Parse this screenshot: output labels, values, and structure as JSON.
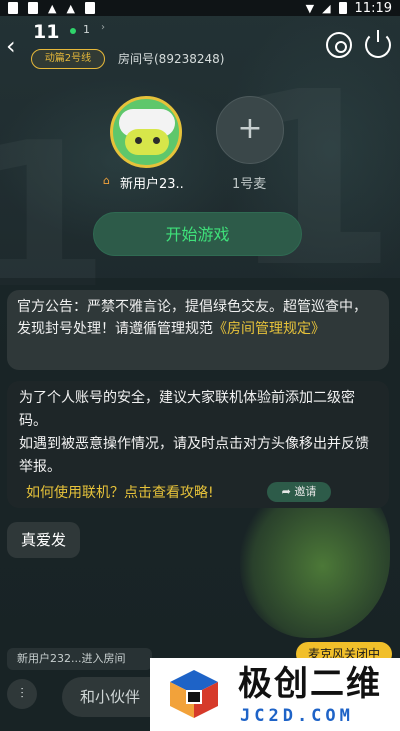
{
  "status_bar": {
    "time": "11:19"
  },
  "header": {
    "room_title": "11",
    "online_count": "1",
    "online_chevron": "›",
    "mode_badge": "动篇2号线",
    "room_number": "房间号(89238248)"
  },
  "seats": [
    {
      "name": "新用户23..",
      "is_host": true
    },
    {
      "name": "1号麦",
      "plus": "+"
    }
  ],
  "start_button": "开始游戏",
  "notice": {
    "text": "官方公告：严禁不雅言论，提倡绿色交友。超管巡查中，发现封号处理！请遵循管理规范",
    "link": "《房间管理规定》"
  },
  "safety": {
    "line1": "为了个人账号的安全，建议大家联机体验前添加二级密码。",
    "line2": "如遇到被恶意操作情况，请及时点击对方头像移出并反馈举报。",
    "guide_link": "如何使用联机？点击查看攻略!",
    "invite_label": "邀请"
  },
  "chat_messages": [
    {
      "text": "真爱发"
    }
  ],
  "system_message": "新用户232...进入房间",
  "mic_status": "麦克风关闭中",
  "input": {
    "value": "和小伙伴"
  },
  "watermark": {
    "title": "极创二维",
    "subtitle": "JC2D.COM"
  },
  "colors": {
    "accent_green": "#3fe07a",
    "accent_gold": "#e6c23a",
    "background": "#1f2b2e"
  }
}
